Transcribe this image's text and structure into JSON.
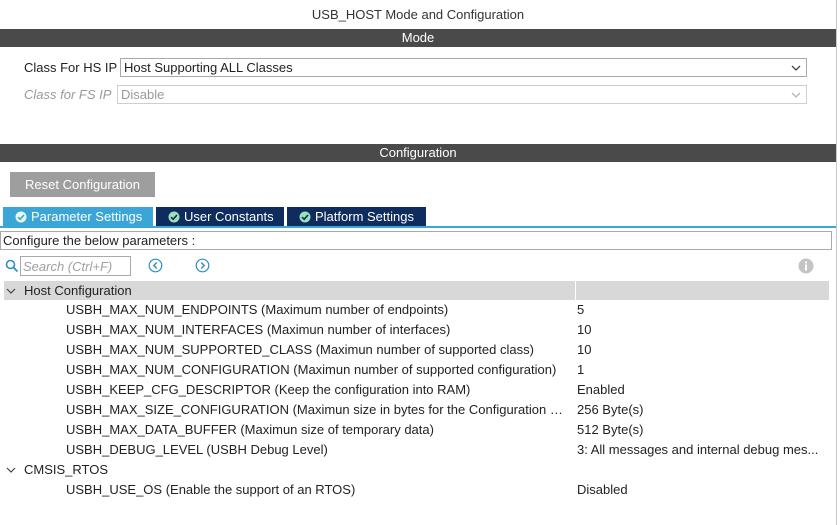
{
  "window_title": "USB_HOST Mode and Configuration",
  "mode_section": {
    "header": "Mode",
    "class_hs": {
      "label": "Class For HS IP",
      "value": "Host Supporting ALL Classes"
    },
    "class_fs": {
      "label": "Class for FS IP",
      "value": "Disable"
    }
  },
  "config_section": {
    "header": "Configuration",
    "reset_button": "Reset Configuration",
    "tabs": [
      {
        "label": "Parameter Settings",
        "active": true
      },
      {
        "label": "User Constants",
        "active": false
      },
      {
        "label": "Platform Settings",
        "active": false
      }
    ],
    "info_text": "Configure the below parameters :",
    "search_placeholder": "Search (Ctrl+F)"
  },
  "groups": [
    {
      "name": "Host Configuration",
      "params": [
        {
          "name": "USBH_MAX_NUM_ENDPOINTS (Maximum number of endpoints)",
          "value": "5"
        },
        {
          "name": "USBH_MAX_NUM_INTERFACES (Maximun number of interfaces)",
          "value": "10"
        },
        {
          "name": "USBH_MAX_NUM_SUPPORTED_CLASS (Maximun number of supported class)",
          "value": "10"
        },
        {
          "name": "USBH_MAX_NUM_CONFIGURATION (Maximun number of supported configuration)",
          "value": "1"
        },
        {
          "name": "USBH_KEEP_CFG_DESCRIPTOR (Keep the configuration into RAM)",
          "value": "Enabled"
        },
        {
          "name": "USBH_MAX_SIZE_CONFIGURATION (Maximun size in bytes for the Configuration De...",
          "value": "256 Byte(s)"
        },
        {
          "name": "USBH_MAX_DATA_BUFFER (Maximun size of temporary data)",
          "value": "512 Byte(s)"
        },
        {
          "name": "USBH_DEBUG_LEVEL (USBH Debug Level)",
          "value": "3: All messages and internal debug mes..."
        }
      ]
    },
    {
      "name": "CMSIS_RTOS",
      "params": [
        {
          "name": "USBH_USE_OS (Enable the support of an RTOS)",
          "value": "Disabled"
        }
      ]
    }
  ],
  "colors": {
    "section_bar": "#4a4a4a",
    "tab_active": "#3aa6d8",
    "tab_inactive": "#0e2c5e",
    "reset_button": "#9e9e9e",
    "tree_header": "#d8d8d8"
  }
}
